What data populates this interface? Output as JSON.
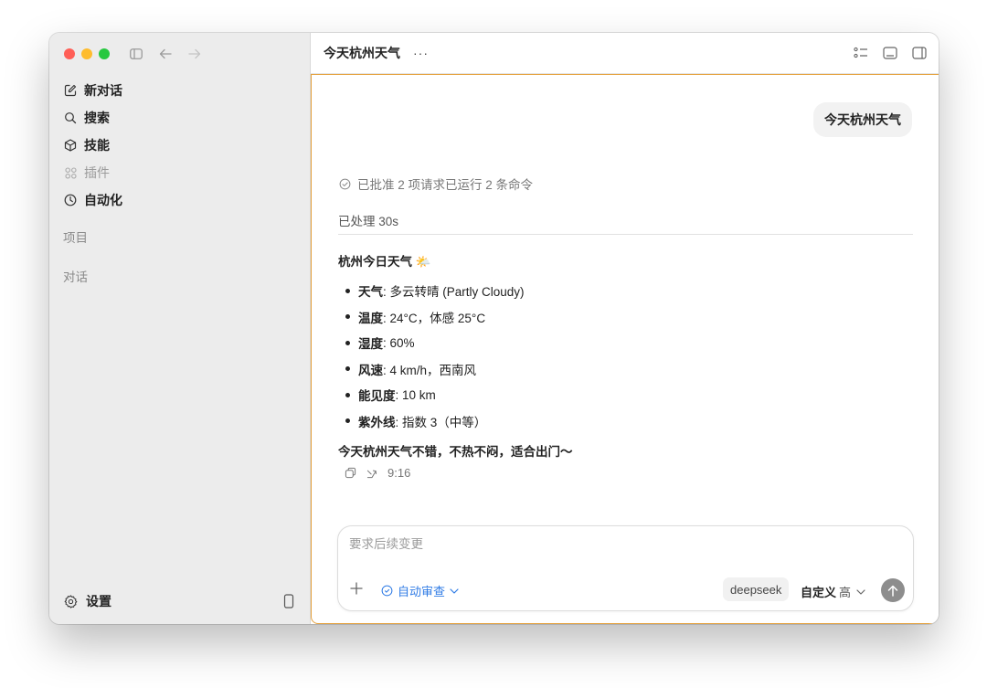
{
  "sidebar": {
    "items": [
      {
        "label": "新对话",
        "icon": "edit-icon"
      },
      {
        "label": "搜索",
        "icon": "search-icon"
      },
      {
        "label": "技能",
        "icon": "cube-icon"
      },
      {
        "label": "插件",
        "icon": "plugin-grid-icon"
      },
      {
        "label": "自动化",
        "icon": "clock-icon"
      }
    ],
    "section_projects": "项目",
    "section_chats": "对话",
    "settings_label": "设置"
  },
  "header": {
    "title": "今天杭州天气",
    "more": "···"
  },
  "chat": {
    "user_message": "今天杭州天气",
    "approval_text": "已批准 2 项请求已运行 2 条命令",
    "processed_text": "已处理 30s",
    "answer_title": "杭州今日天气",
    "answer_emoji": "🌤️",
    "weather_items": [
      {
        "label": "天气",
        "value": ": 多云转晴 (Partly Cloudy)"
      },
      {
        "label": "温度",
        "value": ": 24°C，体感 25°C"
      },
      {
        "label": "湿度",
        "value": ": 60%"
      },
      {
        "label": "风速",
        "value": ": 4 km/h，西南风"
      },
      {
        "label": "能见度",
        "value": ": 10 km"
      },
      {
        "label": "紫外线",
        "value": ": 指数 3（中等）"
      }
    ],
    "summary": "今天杭州天气不错，不热不闷，适合出门～",
    "time": "9:16"
  },
  "composer": {
    "placeholder": "要求后续变更",
    "review_label": "自动审查",
    "model": "deepseek",
    "custom_label": "自定义",
    "level": "高"
  },
  "colors": {
    "accent_border": "#e5a13d",
    "link_blue": "#2f7be5",
    "send_button": "#8d8d8d"
  }
}
